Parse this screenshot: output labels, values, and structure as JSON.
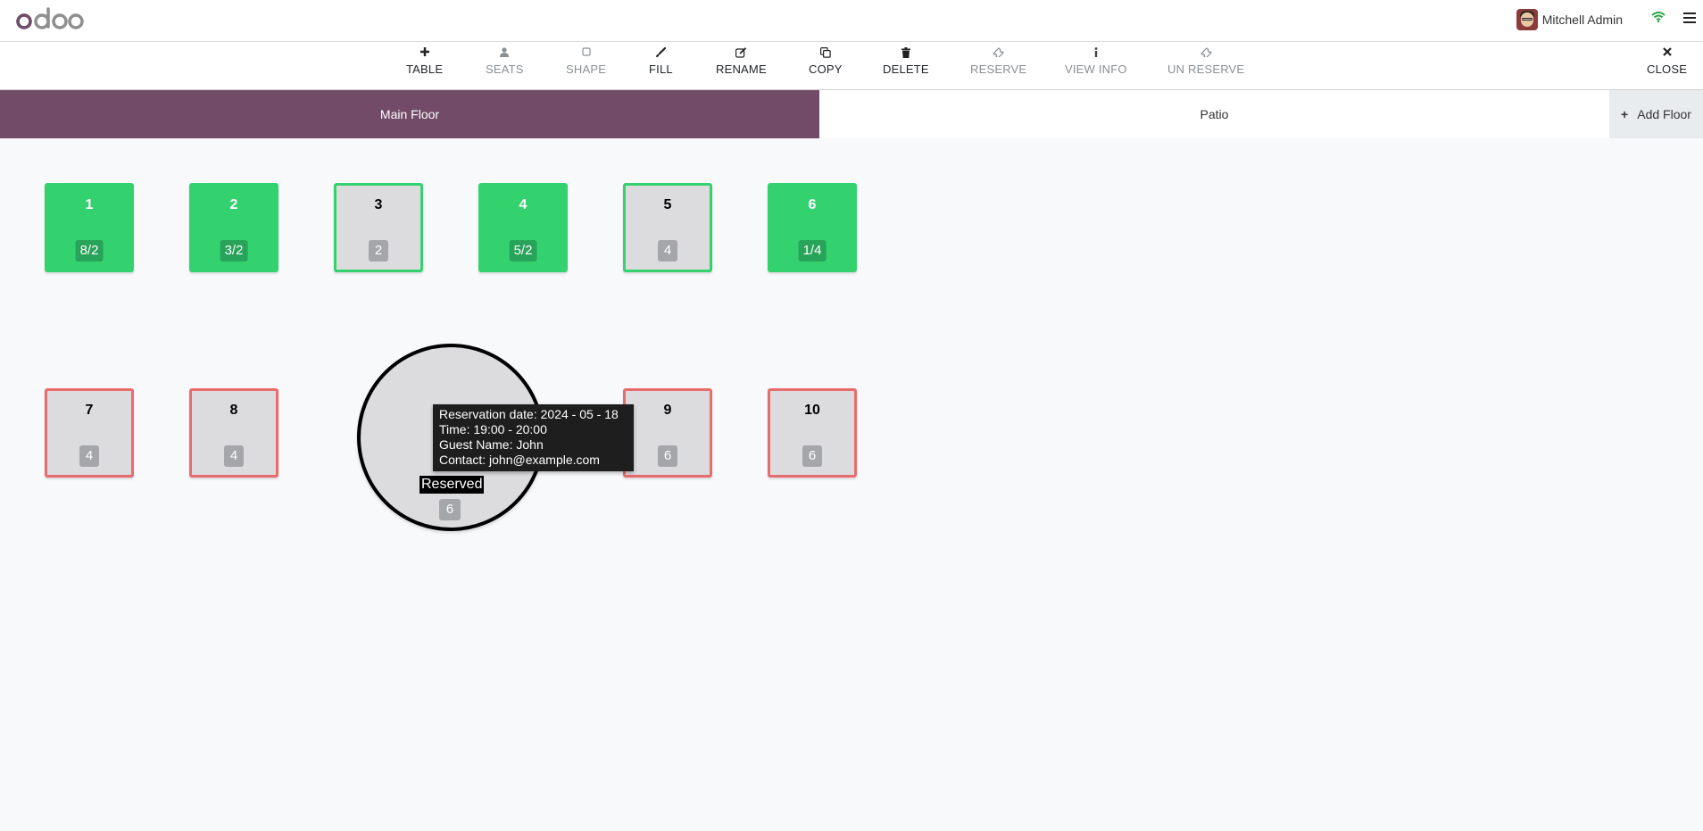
{
  "header": {
    "logo_text": "odoo",
    "user_name": "Mitchell Admin",
    "logo_color": "#714b67",
    "wifi_color": "#28a745"
  },
  "toolbar": {
    "table": "TABLE",
    "seats": "SEATS",
    "shape": "SHAPE",
    "fill": "FILL",
    "rename": "RENAME",
    "copy": "COPY",
    "delete": "DELETE",
    "reserve": "RESERVE",
    "view_info": "VIEW INFO",
    "un_reserve": "UN RESERVE",
    "close": "CLOSE"
  },
  "floors": {
    "main": "Main Floor",
    "patio": "Patio",
    "add": "Add Floor",
    "active_color": "#714b67"
  },
  "tables": [
    {
      "name": "1",
      "seats": "8/2",
      "state": "occupied"
    },
    {
      "name": "2",
      "seats": "3/2",
      "state": "occupied"
    },
    {
      "name": "3",
      "seats": "2",
      "state": "available"
    },
    {
      "name": "4",
      "seats": "5/2",
      "state": "occupied"
    },
    {
      "name": "5",
      "seats": "4",
      "state": "available"
    },
    {
      "name": "6",
      "seats": "1/4",
      "state": "occupied"
    },
    {
      "name": "7",
      "seats": "4",
      "state": "reserved-border"
    },
    {
      "name": "8",
      "seats": "4",
      "state": "reserved-border"
    },
    {
      "name": "9",
      "seats": "6",
      "state": "reserved-border"
    },
    {
      "name": "10",
      "seats": "6",
      "state": "reserved-border"
    }
  ],
  "round_table": {
    "label": "Reserved",
    "seats": "6"
  },
  "tooltip": {
    "line1": "Reservation date: 2024 - 05 - 18",
    "line2": "Time: 19:00 - 20:00",
    "line3": "Guest Name: John",
    "line4": "Contact: john@example.com"
  },
  "colors": {
    "occupied": "#34d26f",
    "available_border": "#34d26f",
    "reserved_border": "#e96c6c"
  }
}
